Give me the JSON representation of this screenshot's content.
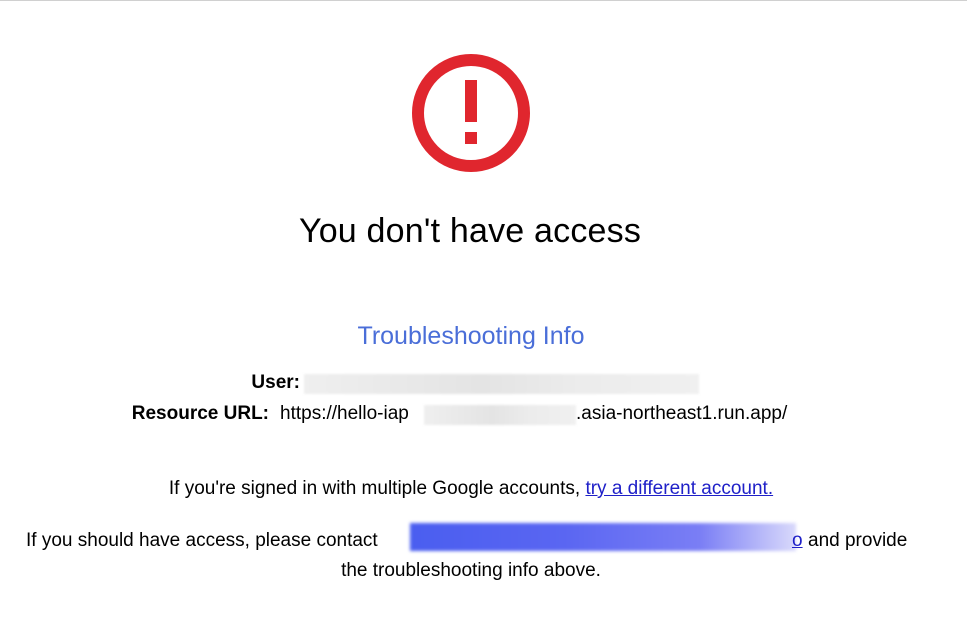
{
  "header": {
    "title": "You don't have access",
    "icon": "error-circle-icon",
    "icon_color": "#e0262e"
  },
  "troubleshooting": {
    "heading": "Troubleshooting Info",
    "user_label": "User:",
    "resource_label": "Resource URL:",
    "resource_url_prefix": "https://hello-iap",
    "resource_url_suffix": ".asia-northeast1.run.app/"
  },
  "multiple_accounts": {
    "text": "If you're signed in with multiple Google accounts,",
    "link_label": "try a different account."
  },
  "contact": {
    "text_before": "If you should have access, please contact",
    "link_tail": "o",
    "text_after": "and provide",
    "line2": "the troubleshooting info above."
  },
  "colors": {
    "heading_blue": "#4a6ed8",
    "link": "#1f20c8"
  }
}
